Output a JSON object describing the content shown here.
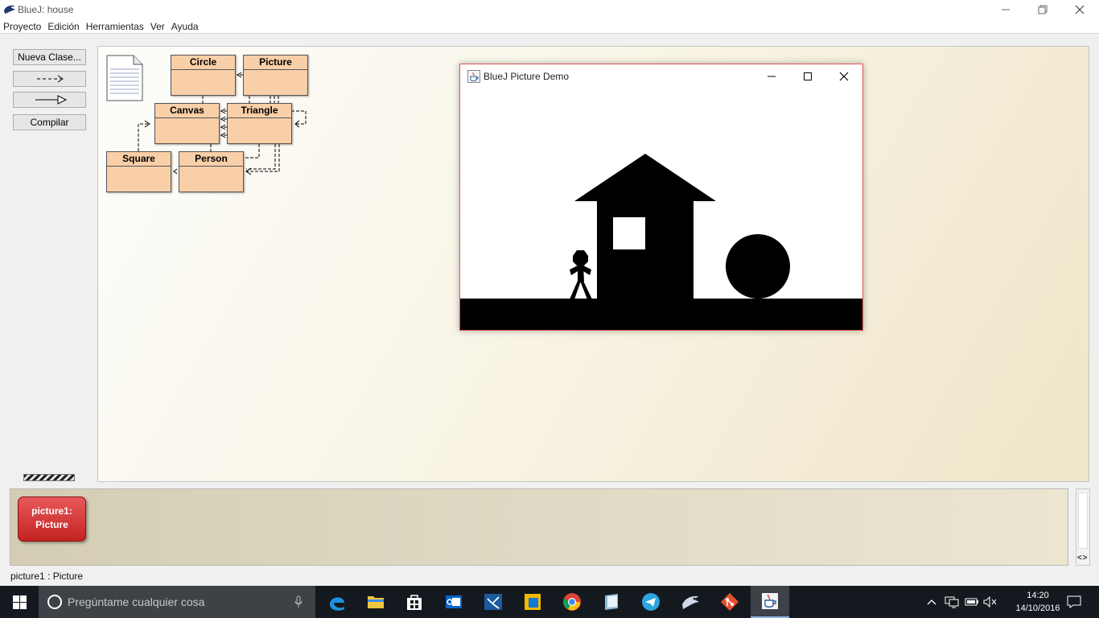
{
  "window": {
    "app_name": "BlueJ:",
    "project": "house"
  },
  "menu": [
    "Proyecto",
    "Edición",
    "Herramientas",
    "Ver",
    "Ayuda"
  ],
  "toolbar": {
    "new_class": "Nueva Clase...",
    "compile": "Compilar"
  },
  "classes": {
    "circle": "Circle",
    "picture": "Picture",
    "canvas": "Canvas",
    "triangle": "Triangle",
    "square": "Square",
    "person": "Person"
  },
  "demo_window": {
    "title": "BlueJ Picture Demo"
  },
  "object_bench": {
    "objects": [
      {
        "name": "picture1:",
        "type": "Picture"
      }
    ]
  },
  "status": "picture1 : Picture",
  "taskbar": {
    "search_placeholder": "Pregúntame cualquier cosa",
    "time": "14:20",
    "date": "14/10/2016"
  },
  "colors": {
    "class_fill": "#f9cfa8",
    "object_card": "#d62b2b",
    "taskbar": "#14191f",
    "canvas_ink": "#000000"
  }
}
